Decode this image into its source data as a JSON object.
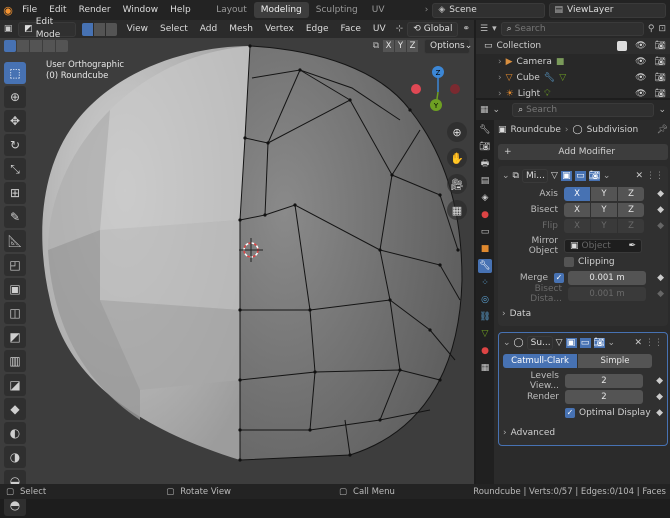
{
  "topbar": {
    "menus": [
      "File",
      "Edit",
      "Render",
      "Window",
      "Help"
    ],
    "workspaces": [
      "Layout",
      "Modeling",
      "Sculpting",
      "UV Editing"
    ],
    "active_workspace": "Modeling",
    "scene": "Scene",
    "view_layer": "ViewLayer"
  },
  "viewport_header": {
    "mode": "Edit Mode",
    "menus": [
      "View",
      "Select",
      "Add",
      "Mesh",
      "Vertex",
      "Edge",
      "Face",
      "UV"
    ],
    "orientation": "Global",
    "axes": [
      "X",
      "Y",
      "Z"
    ],
    "options_label": "Options"
  },
  "viewport": {
    "view_name": "User Orthographic",
    "object_label": "(0) Roundcube",
    "gizmo": {
      "x": "X",
      "y": "Y",
      "z": "Z"
    }
  },
  "outliner": {
    "search_placeholder": "Search",
    "collection": "Collection",
    "items": [
      "Camera",
      "Cube",
      "Light"
    ]
  },
  "properties": {
    "search_placeholder": "Search",
    "breadcrumb_object": "Roundcube",
    "breadcrumb_modifier": "Subdivision",
    "add_modifier": "Add Modifier",
    "mirror": {
      "name": "Mi...",
      "axis_label": "Axis",
      "bisect_label": "Bisect",
      "flip_label": "Flip",
      "axes": [
        "X",
        "Y",
        "Z"
      ],
      "mirror_object_label": "Mirror Object",
      "object_placeholder": "Object",
      "clipping_label": "Clipping",
      "merge_label": "Merge",
      "merge_value": "0.001 m",
      "bisect_distance_label": "Bisect Dista...",
      "bisect_distance_value": "0.001 m",
      "data_label": "Data"
    },
    "subdivision": {
      "name": "Su...",
      "catmull_clark": "Catmull-Clark",
      "simple": "Simple",
      "levels_label": "Levels View...",
      "levels_value": "2",
      "render_label": "Render",
      "render_value": "2",
      "optimal_label": "Optimal Display",
      "advanced_label": "Advanced"
    }
  },
  "statusbar": {
    "select": "Select",
    "rotate": "Rotate View",
    "call_menu": "Call Menu",
    "stats": "Roundcube | Verts:0/57 | Edges:0/104 | Faces"
  },
  "colors": {
    "accent": "#4772b3",
    "x_axis": "#e04854",
    "y_axis": "#6ea022",
    "z_axis": "#3c87d6"
  }
}
